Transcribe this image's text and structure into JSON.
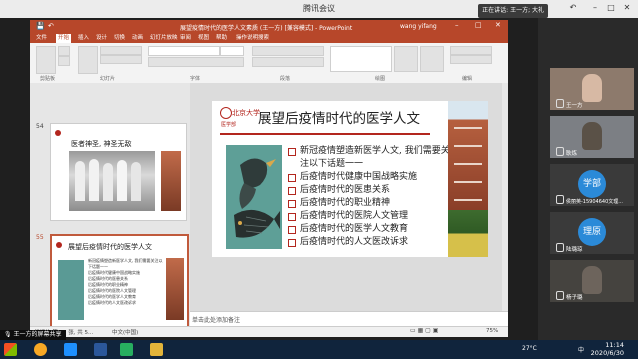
{
  "meeting": {
    "title": "腾讯会议",
    "speaking": "正在讲话: 王一方; 大礼"
  },
  "ppt": {
    "window_title": "展望疫情时代的医学人文素质 (王一方) [兼容模式] - PowerPoint",
    "user": "wang yifang",
    "tabs": [
      "文件",
      "开始",
      "插入",
      "设计",
      "切换",
      "动画",
      "幻灯片放映",
      "审阅",
      "视图",
      "帮助",
      "操作说明搜索"
    ],
    "active_tab": "开始",
    "groups": [
      "剪贴板",
      "幻灯片",
      "字体",
      "段落",
      "绘图",
      "编辑"
    ]
  },
  "thumbnails": [
    {
      "number": "54",
      "title": "医者神圣, 神圣无敌"
    },
    {
      "number": "55",
      "title": "展望后疫情时代的医学人文",
      "bullets": [
        "新冠疫情塑造新医学人文, 我们需要关注以下话题一一",
        "后疫情时代健康中国战略实施",
        "后疫情时代的医患关系",
        "后疫情时代的职业精神",
        "后疫情时代的医院人文管理",
        "后疫情时代的医学人文教育",
        "后疫情时代的人文医改诉求"
      ]
    }
  ],
  "slide": {
    "title": "展望后疫情时代的医学人文",
    "logo_text": "北京大学",
    "sub_label": "医学部",
    "bullets": [
      "新冠疫情塑造新医学人文, 我们需要关注以下话题一一",
      "后疫情时代健康中国战略实施",
      "后疫情时代的医患关系",
      "后疫情时代的职业精神",
      "后疫情时代的医院人文管理",
      "后疫情时代的医学人文教育",
      "后疫情时代的人文医改诉求"
    ]
  },
  "notes_placeholder": "单击此处添加备注",
  "status": {
    "slide_info": "幻灯片 第 55 张, 共 5...",
    "language": "中文(中国)",
    "zoom": "75%"
  },
  "participants": [
    {
      "name": "王一方"
    },
    {
      "name": "耿炼"
    },
    {
      "name": "侯丽英-15904640文理...",
      "avatar_text": "学部",
      "avatar_color": "#2b8ad8"
    },
    {
      "name": "陆璐琼",
      "avatar_text": "理原",
      "avatar_color": "#2b8ad8"
    },
    {
      "name": "杨子璐"
    }
  ],
  "share_label": "王一方的屏幕共享",
  "taskbar": {
    "time": "11:14",
    "date": "2020/6/30",
    "temperature": "27°C",
    "lang": "中"
  },
  "colors": {
    "ppt_red": "#b7472a",
    "bullet_red": "#b3261e"
  }
}
